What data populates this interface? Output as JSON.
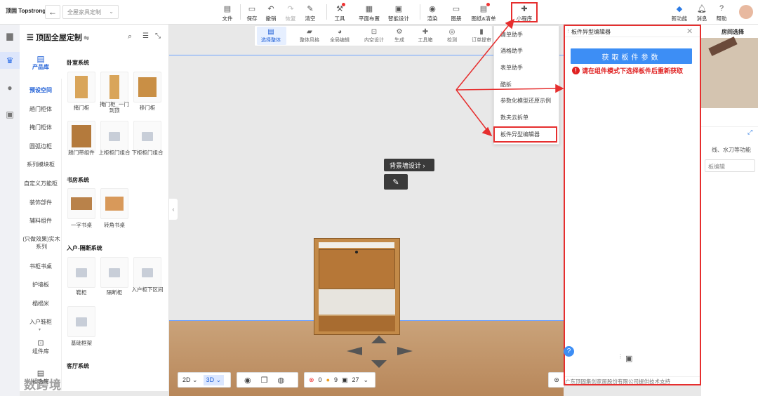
{
  "topbar": {
    "logo": "顶固 Topstrong",
    "project_select": "全屋家具定制",
    "tools": [
      {
        "label": "文件",
        "icon": "file-icon"
      },
      {
        "label": "保存",
        "icon": "save-icon"
      },
      {
        "label": "撤销",
        "icon": "undo-icon"
      },
      {
        "label": "恢复",
        "icon": "redo-icon"
      },
      {
        "label": "清空",
        "icon": "eraser-icon"
      },
      {
        "label": "工具",
        "icon": "wrench-icon"
      },
      {
        "label": "平面布置",
        "icon": "layout-icon"
      },
      {
        "label": "智能设计",
        "icon": "smart-design-icon"
      },
      {
        "label": "渲染",
        "icon": "render-icon"
      },
      {
        "label": "图册",
        "icon": "album-icon"
      },
      {
        "label": "图纸&清单",
        "icon": "drawing-list-icon"
      },
      {
        "label": "小程序",
        "icon": "puzzle-icon"
      }
    ],
    "right": [
      {
        "label": "新功能"
      },
      {
        "label": "消息"
      },
      {
        "label": "帮助"
      }
    ]
  },
  "panel": {
    "title": "顶固全屋定制",
    "nav": [
      {
        "label": "产品库"
      },
      {
        "label": "预设空间"
      },
      {
        "label": "趟门柜体"
      },
      {
        "label": "掩门柜体"
      },
      {
        "label": "圆弧边柜"
      },
      {
        "label": "系列模块柜"
      },
      {
        "label": "自定义万能柜"
      },
      {
        "label": "装饰部件"
      },
      {
        "label": "辅料组件"
      },
      {
        "label": "(只做效果)实木系列"
      },
      {
        "label": "书柜书桌"
      },
      {
        "label": "护墙板"
      },
      {
        "label": "榻榻米"
      },
      {
        "label": "入户鞋柜"
      },
      {
        "label": "组件库"
      },
      {
        "label": "组合库"
      }
    ],
    "sections": [
      {
        "title": "卧室系统",
        "items": [
          "掩门柜",
          "掩门柜_一门到顶",
          "移门柜",
          "趟门带组件",
          "上柜柜门组合",
          "下柜柜门组合"
        ]
      },
      {
        "title": "书房系统",
        "items": [
          "一字书桌",
          "转角书桌"
        ]
      },
      {
        "title": "入户-隔断系统",
        "items": [
          "鞋柜",
          "隔断柜",
          "入户柜下区间",
          "基础框架"
        ]
      },
      {
        "title": "客厅系统",
        "items": []
      }
    ]
  },
  "subtoolbar": [
    "选择整体",
    "整体风格",
    "全局编辑",
    "内空设计",
    "生成",
    "工具箱",
    "检测",
    "订单提审"
  ],
  "dropdown": [
    "清单助手",
    "酒格助手",
    "表单助手",
    "酷拆",
    "参数化模型还原示例",
    "数夫云拆单",
    "板件异型编辑器"
  ],
  "canvas": {
    "bg_wall_label": "背景墙设计 ›",
    "view_2d": "2D",
    "view_3d": "3D",
    "err_count": "0",
    "warn_count": "9",
    "cab_count": "27"
  },
  "editor": {
    "title": "板件异型编辑器",
    "get_button": "获取板件参数",
    "error": "请在组件模式下选择板件后重新获取",
    "footer": "广东顶固集创家居股份有限公司提供技术支持"
  },
  "room": {
    "title": "房间选择",
    "text1": "线、水刀等功能",
    "text2": "板编辑"
  },
  "watermark": "数跨境"
}
